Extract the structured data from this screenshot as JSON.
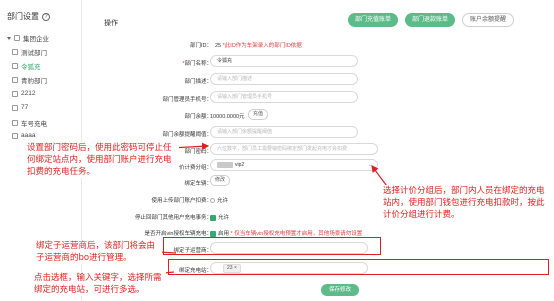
{
  "sidebar": {
    "title": "部门设置",
    "items": [
      {
        "label": "集团企业",
        "type": "root"
      },
      {
        "label": "测试部门",
        "type": "child"
      },
      {
        "label": "令狐充",
        "type": "child-active"
      },
      {
        "label": "青豹部门",
        "type": "child"
      },
      {
        "label": "2212",
        "type": "child"
      },
      {
        "label": "77",
        "type": "child"
      },
      {
        "label": "车号充电",
        "type": "child"
      },
      {
        "label": "aaaa",
        "type": "child"
      }
    ]
  },
  "header": {
    "ops_label": "操作",
    "btn_recharge": "部门充值账单",
    "btn_refund": "部门退款账单",
    "btn_alert": "账户余额提醒"
  },
  "form": {
    "dept_id_label": "部门ID：",
    "dept_id_value": "25",
    "dept_id_note": "*此ID作为车架录入的部门ID依据",
    "name_label": "部门名称：",
    "name_value": "令狐充",
    "desc_label": "部门描述：",
    "desc_placeholder": "请输入部门描述",
    "phone_label": "部门管理员手机号：",
    "phone_placeholder": "请输入部门管理员手机号",
    "balance_label": "部门余额：",
    "balance_value": "10000.0000元",
    "balance_btn": "充值",
    "alert_label": "部门余额提醒阈值：",
    "alert_placeholder": "请输入部门余额提醒阈值",
    "pwd_label": "部门密码：",
    "pwd_placeholder": "六位数字，部门员工需要输密码绑定部门发起充电才会扣费",
    "billing_label": "电价计费分组：",
    "billing_value": "vip2",
    "car_label": "绑定车辆：",
    "car_btn": "修改",
    "upload_label": "使用上传部门账户扣费：",
    "upload_value": "允许",
    "stop_label": "停止回部门其他用户充电事务：",
    "stop_value": "允许",
    "vin_label": "是否开启vin授权车辆充电：",
    "vin_value": "启用",
    "vin_note": "* 仅当车辆vin授权充电预置才启用，其他场景请勿设置",
    "operator_label": "绑定子运营商：",
    "station_label": "绑定充电站：",
    "station_tag": "23",
    "save_btn": "保存修改"
  },
  "annotations": {
    "a1": "设置部门密码后，使用此密码可停止任何绑定站点内，使用部门账户进行充电扣费的充电任务。",
    "a2": "选择计价分组后，部门内人员在绑定的充电站内，使用部门钱包进行充电扣款时，按此计价分组进行计费。",
    "a3": "绑定子运营商后，该部门将会由子运营商的bo进行管理。",
    "a4": "点击选框，输入关键字，选择所需绑定的充电站，可进行多选。"
  }
}
